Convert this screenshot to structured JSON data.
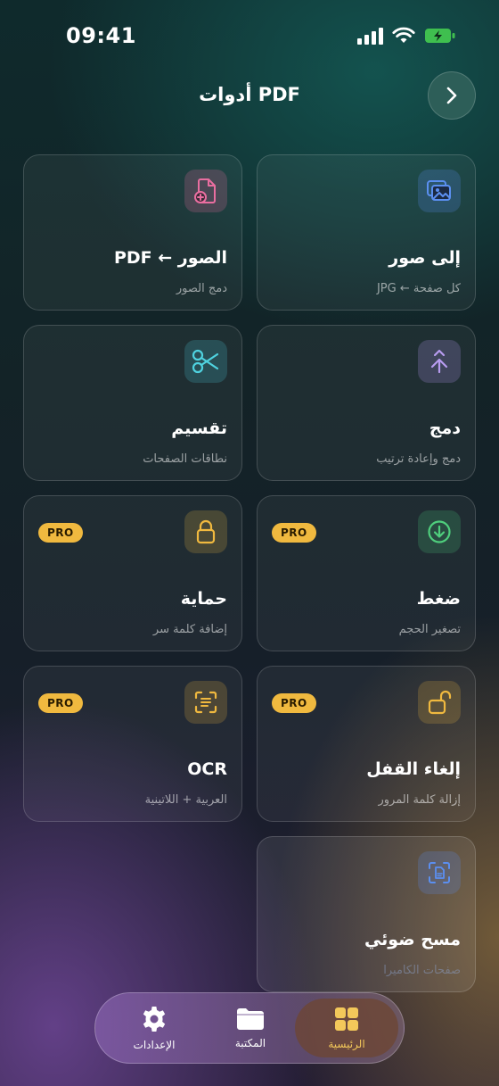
{
  "status_bar": {
    "time": "09:41"
  },
  "header": {
    "title": "أدوات PDF"
  },
  "cards": [
    {
      "title": "إلى صور",
      "subtitle": "كل صفحة ← JPG",
      "icon": "images-icon",
      "pro": false
    },
    {
      "title": "الصور ← PDF",
      "subtitle": "دمج الصور",
      "icon": "file-add-icon",
      "pro": false
    },
    {
      "title": "دمج",
      "subtitle": "دمج وإعادة ترتيب",
      "icon": "merge-icon",
      "pro": false
    },
    {
      "title": "تقسيم",
      "subtitle": "نطاقات الصفحات",
      "icon": "scissors-icon",
      "pro": false
    },
    {
      "title": "ضغط",
      "subtitle": "تصغير الحجم",
      "icon": "download-circle-icon",
      "pro": true,
      "badge": "PRO"
    },
    {
      "title": "حماية",
      "subtitle": "إضافة كلمة سر",
      "icon": "lock-icon",
      "pro": true,
      "badge": "PRO"
    },
    {
      "title": "إلغاء القفل",
      "subtitle": "إزالة كلمة المرور",
      "icon": "unlock-icon",
      "pro": true,
      "badge": "PRO"
    },
    {
      "title": "OCR",
      "subtitle": "العربية + اللاتينية",
      "icon": "text-scan-icon",
      "pro": true,
      "badge": "PRO"
    },
    {
      "title": "مسح ضوئي",
      "subtitle": "صفحات الكاميرا",
      "icon": "document-scan-icon",
      "pro": false
    }
  ],
  "tabbar": {
    "home": "الرئيسية",
    "library": "المكتبة",
    "settings": "الإعدادات",
    "active": "home"
  },
  "colors": {
    "accent_gold": "#f3c85a",
    "blue": "#5b8ff0",
    "pink": "#e96ea0",
    "cyan": "#4fd2e0",
    "purple": "#b89cf0",
    "green": "#4fcf7d",
    "amber": "#f0b93f"
  }
}
